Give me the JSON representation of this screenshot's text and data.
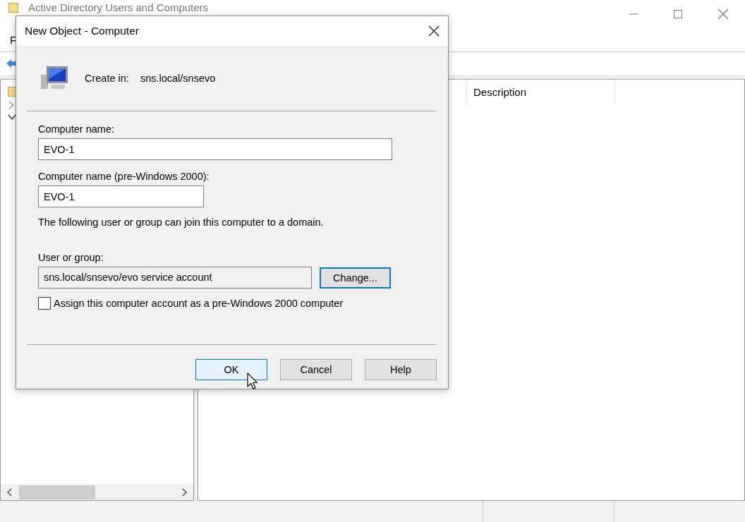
{
  "main_window": {
    "title": "Active Directory Users and Computers",
    "menu": [
      "F"
    ],
    "columns": [
      "Description"
    ]
  },
  "dialog": {
    "title": "New Object - Computer",
    "create_in_label": "Create in:",
    "create_in_value": "sns.local/snsevo",
    "fields": [
      {
        "label": "Computer name:",
        "value": "EVO-1",
        "kind": "wide"
      },
      {
        "label": "Computer name (pre-Windows 2000):",
        "value": "EVO-1",
        "kind": "narrow"
      }
    ],
    "info": "The following user or group can join this computer to a domain.",
    "user_group": {
      "label": "User or group:",
      "value": "sns.local/snsevo/evo service account",
      "button": "Change...",
      "focused": true
    },
    "checkbox": {
      "label": "Assign this computer account as a pre-Windows 2000 computer",
      "checked": false
    },
    "buttons": [
      {
        "label": "OK",
        "kind": "default",
        "hovered": true
      },
      {
        "label": "Cancel",
        "kind": "normal",
        "hovered": false
      },
      {
        "label": "Help",
        "kind": "normal",
        "hovered": false
      }
    ]
  }
}
